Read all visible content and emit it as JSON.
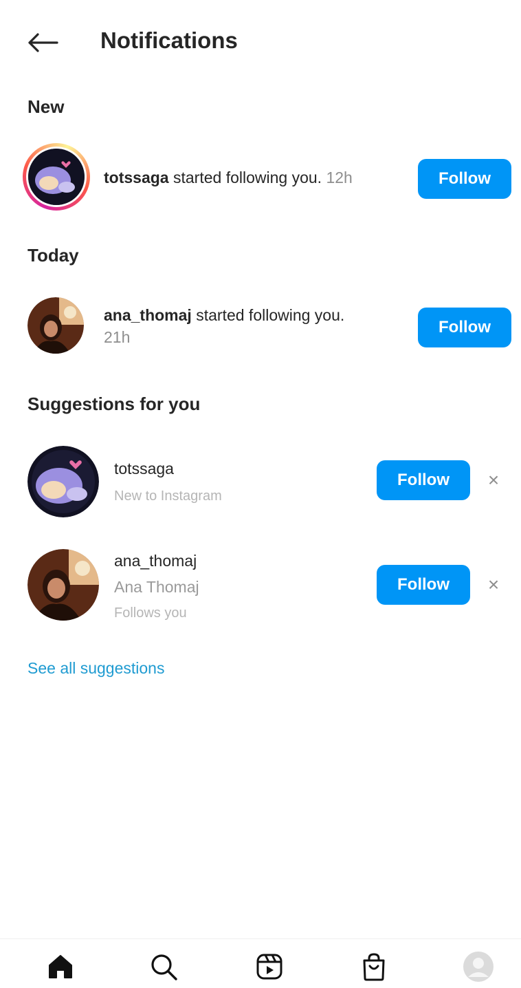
{
  "header": {
    "title": "Notifications",
    "back_icon": "arrow-left-icon"
  },
  "sections": {
    "new_title": "New",
    "today_title": "Today",
    "suggestions_title": "Suggestions for you"
  },
  "notifications": [
    {
      "username": "totssaga",
      "message": " started following you.",
      "time": "12h",
      "button_label": "Follow"
    },
    {
      "username": "ana_thomaj",
      "message": " started following you.",
      "time": "21h",
      "button_label": "Follow"
    }
  ],
  "suggestions": [
    {
      "username": "totssaga",
      "subtitle": "New to Instagram",
      "button_label": "Follow",
      "dismiss": "×"
    },
    {
      "username": "ana_thomaj",
      "full_name": "Ana Thomaj",
      "subtitle": "Follows you",
      "button_label": "Follow",
      "dismiss": "×"
    }
  ],
  "see_all_label": "See all suggestions",
  "bottom_nav": {
    "items": [
      "home-icon",
      "search-icon",
      "reels-icon",
      "shop-icon",
      "profile-icon"
    ]
  },
  "colors": {
    "primary": "#0095f6",
    "link": "#1f9bd1",
    "muted": "#8e8e8e"
  }
}
